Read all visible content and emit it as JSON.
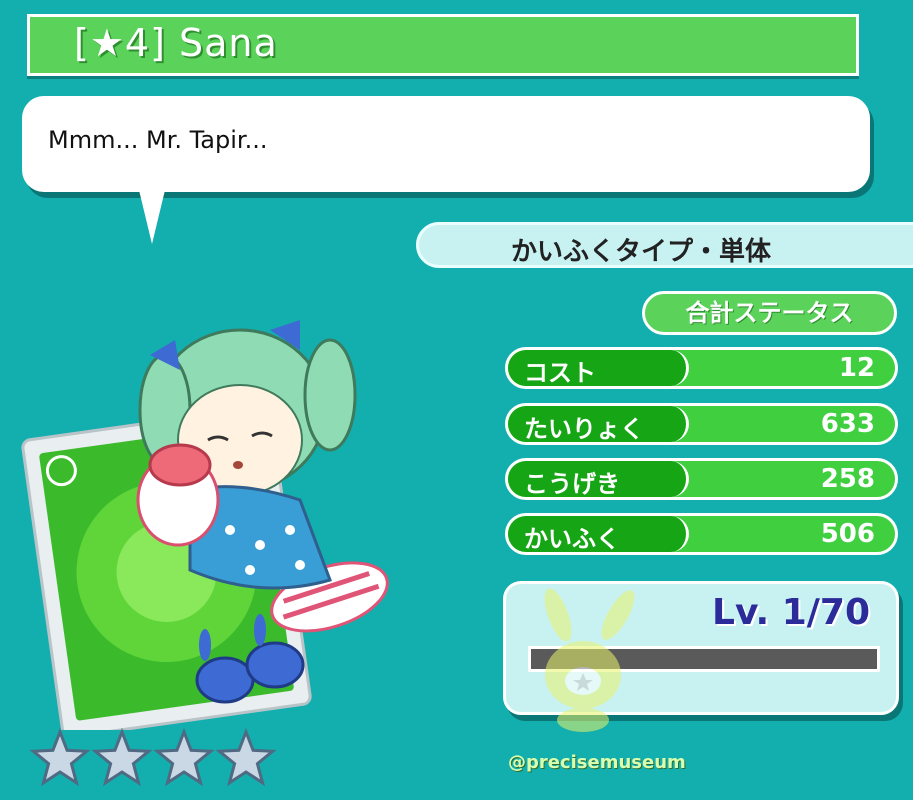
{
  "header": {
    "title": "[★4] Sana"
  },
  "dialogue": {
    "text": "Mmm... Mr. Tapir..."
  },
  "skill_type": {
    "label": "かいふくタイプ・単体"
  },
  "status": {
    "header": "合計ステータス",
    "rows": [
      {
        "label": "コスト",
        "value": "12"
      },
      {
        "label": "たいりょく",
        "value": "633"
      },
      {
        "label": "こうげき",
        "value": "258"
      },
      {
        "label": "かいふく",
        "value": "506"
      }
    ]
  },
  "level": {
    "text": "Lv. 1/70",
    "current": 1,
    "max": 70,
    "exp_fraction": 0
  },
  "rarity": {
    "stars": 4
  },
  "watermark": {
    "text": "@precisemuseum"
  },
  "colors": {
    "background": "#13aeae",
    "accent_green": "#5bd35b",
    "dark_green": "#15a515",
    "level_text": "#2b2b9a"
  },
  "icons": [
    "star-icon",
    "leaf-icon",
    "character-art",
    "mascot-art"
  ]
}
